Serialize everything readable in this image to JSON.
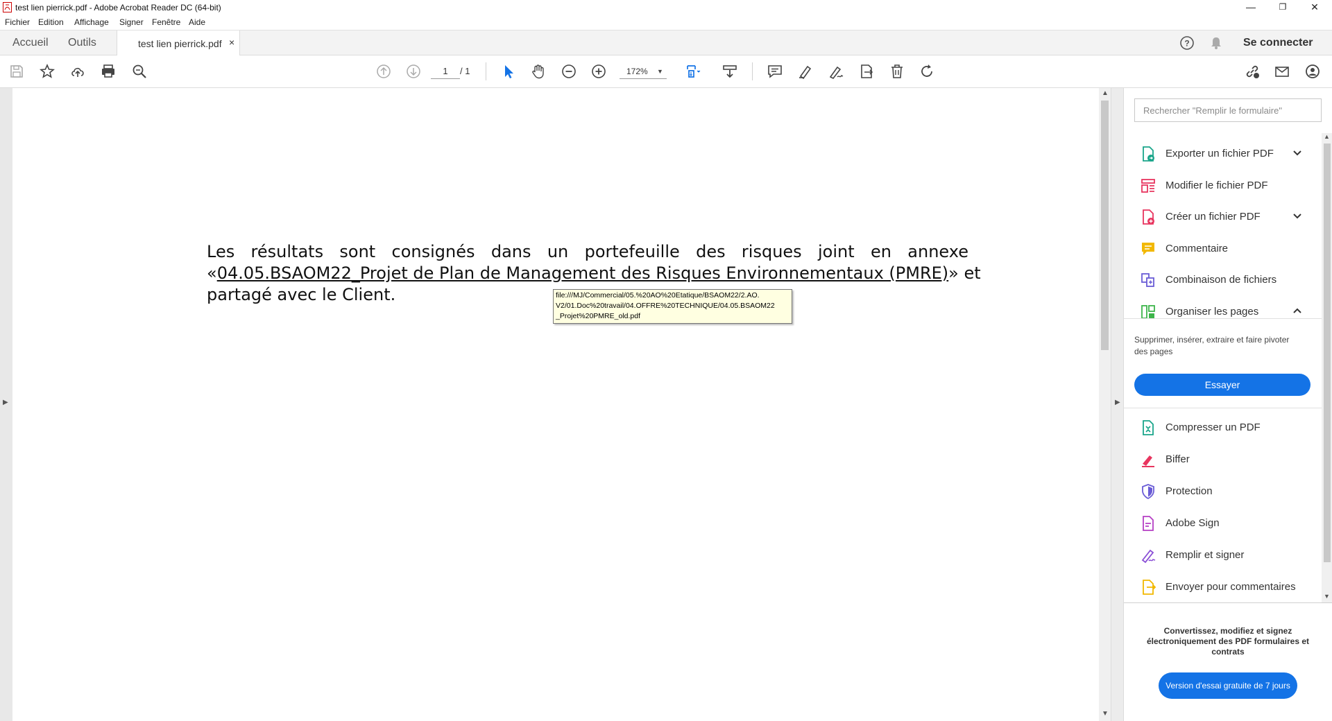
{
  "window": {
    "title": "test lien pierrick.pdf - Adobe Acrobat Reader DC (64-bit)",
    "controls": {
      "minimize": "—",
      "restore": "❐",
      "close": "✕"
    }
  },
  "menu": [
    "Fichier",
    "Edition",
    "Affichage",
    "Signer",
    "Fenêtre",
    "Aide"
  ],
  "tabs": {
    "home": "Accueil",
    "tools": "Outils",
    "document": "test lien pierrick.pdf",
    "close": "×",
    "sign_in": "Se connecter"
  },
  "toolbar": {
    "page_current": "1",
    "page_total": "/ 1",
    "zoom": "172%",
    "icons": [
      "save-icon",
      "bookmark-star-icon",
      "upload-cloud-icon",
      "print-icon",
      "search-zoom-icon",
      "page-up-icon",
      "page-down-icon",
      "select-cursor-icon",
      "hand-icon",
      "zoom-out-icon",
      "zoom-in-icon",
      "fit-page-icon",
      "scroll-mode-icon",
      "comment-icon",
      "highlight-pen-icon",
      "sign-icon",
      "send-icon",
      "delete-icon",
      "rotate-icon"
    ],
    "right_icons": [
      "share-link-icon",
      "email-icon",
      "account-icon"
    ],
    "colors": {
      "active": "#1473e6",
      "inactive": "#555555"
    }
  },
  "document": {
    "line1": [
      "Les",
      "résultats",
      "sont",
      "consignés",
      "dans",
      "un",
      "portefeuille",
      "des",
      "risques",
      "joint",
      "en",
      "annexe"
    ],
    "line2_prefix": "«",
    "link_text": "04.05.BSAOM22_Projet de Plan de Management des Risques Environnementaux (PMRE)",
    "line2_suffix": "» et",
    "line3": "partagé avec le Client.",
    "tooltip": "file:///MJ/Commercial/05.%20AO%20Etatique/BSAOM22/2.AO.\nV2/01.Doc%20travail/04.OFFRE%20TECHNIQUE/04.05.BSAOM22\n_Projet%20PMRE_old.pdf"
  },
  "right_pane": {
    "search_placeholder": "Rechercher \"Remplir le formulaire\"",
    "tools": [
      {
        "label": "Exporter un fichier PDF",
        "icon": "export-pdf-icon",
        "color": "#1aa58a",
        "chevron": "down"
      },
      {
        "label": "Modifier le fichier PDF",
        "icon": "edit-pdf-icon",
        "color": "#e8355f"
      },
      {
        "label": "Créer un fichier PDF",
        "icon": "create-pdf-icon",
        "color": "#e8355f",
        "chevron": "down"
      },
      {
        "label": "Commentaire",
        "icon": "comment-icon",
        "color": "#f2b800"
      },
      {
        "label": "Combinaison de fichiers",
        "icon": "combine-files-icon",
        "color": "#6a5cd6"
      },
      {
        "label": "Organiser les pages",
        "icon": "organize-pages-icon",
        "color": "#3db54a",
        "chevron": "up"
      }
    ],
    "organize_desc": "Supprimer, insérer, extraire et faire pivoter des pages",
    "try_button": "Essayer",
    "tools2": [
      {
        "label": "Compresser un PDF",
        "icon": "compress-pdf-icon",
        "color": "#1aa58a"
      },
      {
        "label": "Biffer",
        "icon": "redact-icon",
        "color": "#e8355f"
      },
      {
        "label": "Protection",
        "icon": "protect-shield-icon",
        "color": "#6a5cd6"
      },
      {
        "label": "Adobe Sign",
        "icon": "adobe-sign-icon",
        "color": "#b53fc4"
      },
      {
        "label": "Remplir et signer",
        "icon": "fill-sign-icon",
        "color": "#8a4fd6"
      },
      {
        "label": "Envoyer pour commentaires",
        "icon": "send-review-icon",
        "color": "#f2b800"
      }
    ],
    "promo_text": "Convertissez, modifiez et signez électroniquement des PDF formulaires et contrats",
    "trial_button": "Version d'essai gratuite de 7 jours"
  }
}
